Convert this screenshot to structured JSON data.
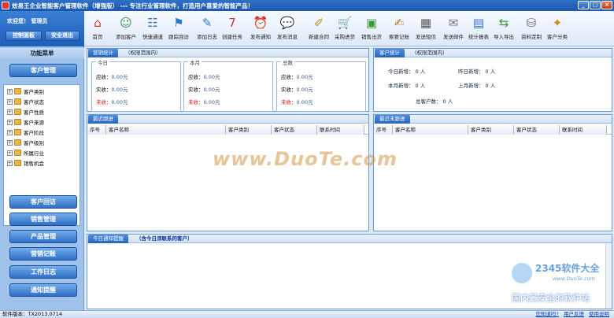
{
  "window": {
    "title": "效易王企业智能客户管理软件（增强版） --- 专注行业管理软件，打造用户喜爱的智能产品！",
    "min": "_",
    "max": "□",
    "close": "×"
  },
  "sidebar": {
    "welcome": "欢迎您！ 管理员",
    "control_panel": "控制面板",
    "safe_exit": "安全退出",
    "menu_title": "功能菜单",
    "customer_mgmt": "客户管理",
    "tree": [
      "客户类别",
      "客户状态",
      "客户性质",
      "客户来源",
      "客户阶段",
      "客户级别",
      "所属行业",
      "销售机会"
    ],
    "nav": [
      "客户回访",
      "销售管理",
      "产品管理",
      "营销记账",
      "工作日志",
      "通知提醒"
    ]
  },
  "toolbar": [
    {
      "label": "首页",
      "icon": "home-icon",
      "glyph": "⌂",
      "color": "#c9362b"
    },
    {
      "label": "添加客户",
      "icon": "add-customer-icon",
      "glyph": "☺",
      "color": "#3b8c3b"
    },
    {
      "label": "快速通道",
      "icon": "fast-channel-icon",
      "glyph": "☷",
      "color": "#3a6fb8"
    },
    {
      "label": "跟踪回访",
      "icon": "flag-icon",
      "glyph": "⚑",
      "color": "#2f78c4"
    },
    {
      "label": "添加日志",
      "icon": "log-icon",
      "glyph": "✎",
      "color": "#2f78c4"
    },
    {
      "label": "创建任务",
      "icon": "calendar-icon",
      "glyph": "7",
      "color": "#c33"
    },
    {
      "label": "发布通知",
      "icon": "clock-icon",
      "glyph": "⏰",
      "color": "#e0a020"
    },
    {
      "label": "发布消息",
      "icon": "message-icon",
      "glyph": "💬",
      "color": "#e8b820"
    },
    {
      "label": "新建合同",
      "icon": "contract-icon",
      "glyph": "✐",
      "color": "#c98a2a"
    },
    {
      "label": "采购进货",
      "icon": "cart-icon",
      "glyph": "🛒",
      "color": "#2f8c3c"
    },
    {
      "label": "销售出货",
      "icon": "box-icon",
      "glyph": "▣",
      "color": "#3d9a3a"
    },
    {
      "label": "索要记账",
      "icon": "ledger-icon",
      "glyph": "✍",
      "color": "#b87a20"
    },
    {
      "label": "发送短信",
      "icon": "phone-icon",
      "glyph": "▦",
      "color": "#555"
    },
    {
      "label": "发送邮件",
      "icon": "mail-icon",
      "glyph": "✉",
      "color": "#777"
    },
    {
      "label": "统计报表",
      "icon": "report-icon",
      "glyph": "▤",
      "color": "#2f6fc8"
    },
    {
      "label": "导入导出",
      "icon": "import-export-icon",
      "glyph": "⇆",
      "color": "#3a9a3a"
    },
    {
      "label": "资料定制",
      "icon": "database-icon",
      "glyph": "⛁",
      "color": "#666"
    },
    {
      "label": "客户分类",
      "icon": "magic-wand-icon",
      "glyph": "✦",
      "color": "#d08a20"
    }
  ],
  "sales_panel": {
    "tab": "营销统计",
    "scope": "（权限范围内）",
    "groups": [
      {
        "label": "今日",
        "receivable": "0.00元",
        "received": "0.00元",
        "unreceived": "0.00元"
      },
      {
        "label": "本月",
        "receivable": "0.00元",
        "received": "0.00元",
        "unreceived": "0.00元"
      },
      {
        "label": "总数",
        "receivable": "0.00元",
        "received": "0.00元",
        "unreceived": "0.00元"
      }
    ],
    "receivable_label": "应收：",
    "received_label": "实收：",
    "unreceived_label": "未收："
  },
  "customer_stats": {
    "tab": "客户统计",
    "scope": "（权限范围内）",
    "today_new": "今日新增：",
    "today_val": "0 人",
    "yesterday_new": "昨日新增：",
    "yesterday_val": "0 人",
    "month_new": "本月新增：",
    "month_val": "0 人",
    "last_month_new": "上月新增：",
    "last_month_val": "0 人",
    "total": "总客户数：",
    "total_val": "0 人"
  },
  "recent_follow": {
    "tab": "最近跟进",
    "columns": [
      "序号",
      "客户名称",
      "客户类别",
      "客户状态",
      "联系时间"
    ]
  },
  "recent_unfollow": {
    "tab": "最近未跟进",
    "columns": [
      "序号",
      "客户名称",
      "客户类别",
      "客户状态",
      "联系时间"
    ]
  },
  "today_notice": {
    "tab": "今日通知提醒",
    "sub": "（含今日须联系的客户）"
  },
  "status": {
    "version": "软件版本：TX2013.0714",
    "links": [
      "您知道吗?",
      "用户反馈",
      "使用说明"
    ]
  },
  "watermark": {
    "main": "www.DuoTe.com",
    "brand": "2345软件大全",
    "url": "www.DuoTe.com",
    "slogan": "国内最安全的软件站"
  }
}
